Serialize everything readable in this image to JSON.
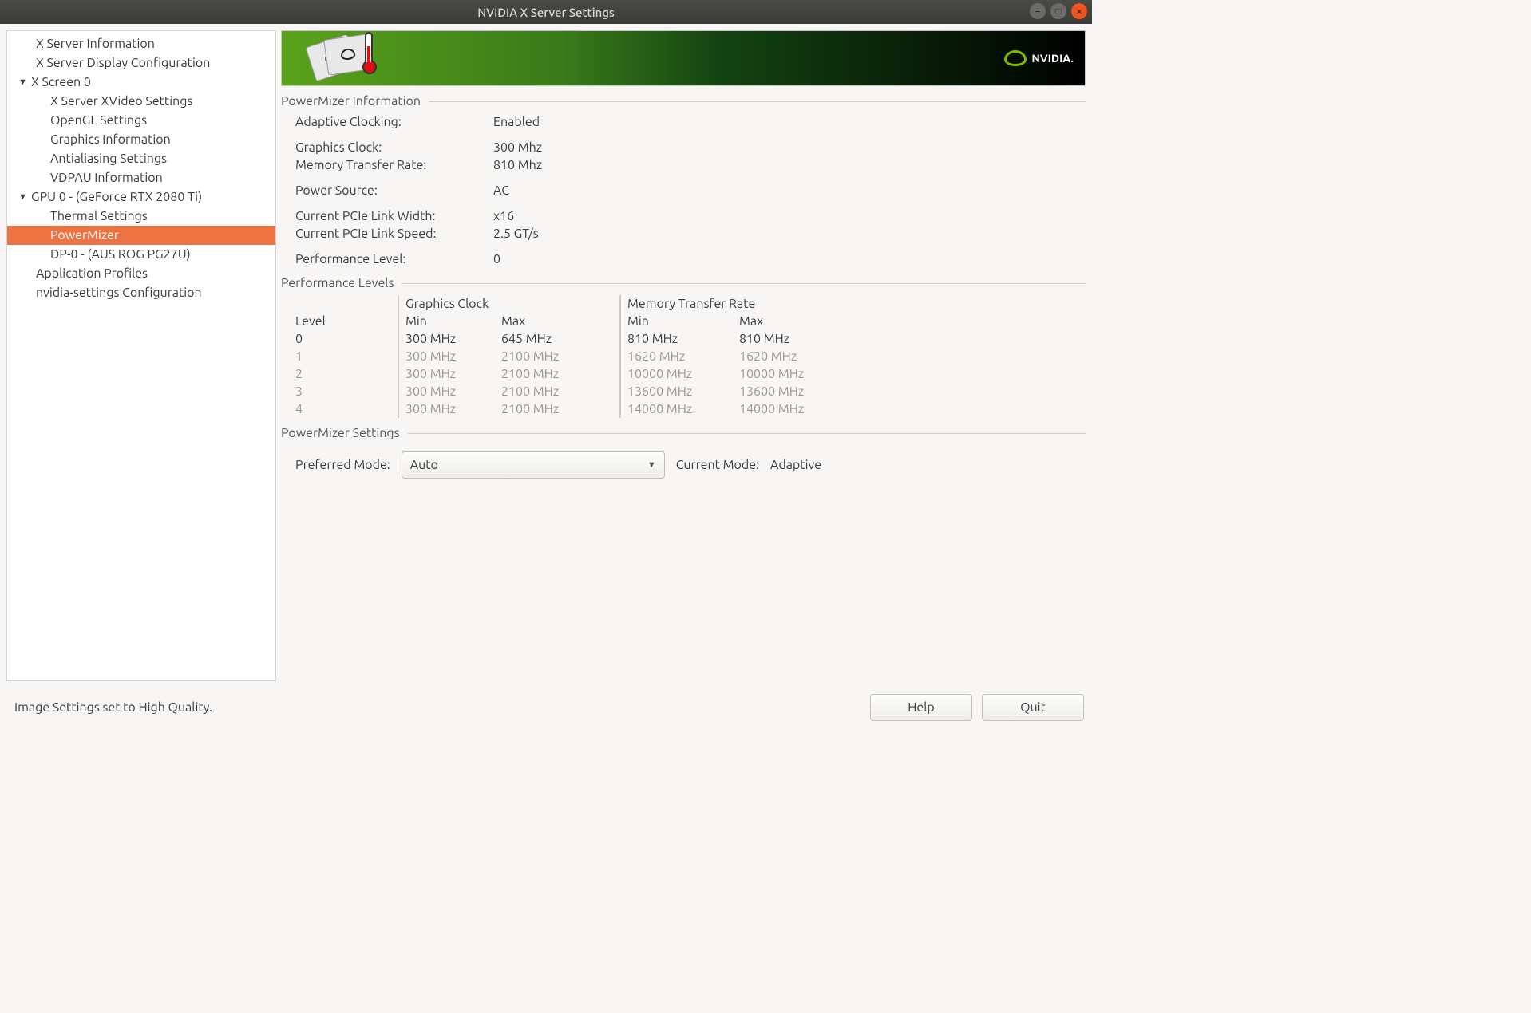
{
  "window": {
    "title": "NVIDIA X Server Settings"
  },
  "sidebar": {
    "items": [
      {
        "label": "X Server Information",
        "level": 1,
        "expandable": false
      },
      {
        "label": "X Server Display Configuration",
        "level": 1,
        "expandable": false
      },
      {
        "label": "X Screen 0",
        "level": 0,
        "expandable": true
      },
      {
        "label": "X Server XVideo Settings",
        "level": 2,
        "expandable": false
      },
      {
        "label": "OpenGL Settings",
        "level": 2,
        "expandable": false
      },
      {
        "label": "Graphics Information",
        "level": 2,
        "expandable": false
      },
      {
        "label": "Antialiasing Settings",
        "level": 2,
        "expandable": false
      },
      {
        "label": "VDPAU Information",
        "level": 2,
        "expandable": false
      },
      {
        "label": "GPU 0 - (GeForce RTX 2080 Ti)",
        "level": 0,
        "expandable": true
      },
      {
        "label": "Thermal Settings",
        "level": 2,
        "expandable": false
      },
      {
        "label": "PowerMizer",
        "level": 2,
        "expandable": false,
        "selected": true
      },
      {
        "label": "DP-0 - (AUS ROG PG27U)",
        "level": 2,
        "expandable": false
      },
      {
        "label": "Application Profiles",
        "level": 1,
        "expandable": false
      },
      {
        "label": "nvidia-settings Configuration",
        "level": 1,
        "expandable": false
      }
    ]
  },
  "sections": {
    "info_title": "PowerMizer Information",
    "levels_title": "Performance Levels",
    "settings_title": "PowerMizer Settings"
  },
  "info": {
    "adaptive_clocking_label": "Adaptive Clocking:",
    "adaptive_clocking_value": "Enabled",
    "graphics_clock_label": "Graphics Clock:",
    "graphics_clock_value": "300 Mhz",
    "mem_rate_label": "Memory Transfer Rate:",
    "mem_rate_value": "810 Mhz",
    "power_source_label": "Power Source:",
    "power_source_value": "AC",
    "pcie_width_label": "Current PCIe Link Width:",
    "pcie_width_value": "x16",
    "pcie_speed_label": "Current PCIe Link Speed:",
    "pcie_speed_value": "2.5 GT/s",
    "perf_level_label": "Performance Level:",
    "perf_level_value": "0"
  },
  "perf_headers": {
    "level": "Level",
    "graphics_clock": "Graphics Clock",
    "memory_rate": "Memory Transfer Rate",
    "min": "Min",
    "max": "Max"
  },
  "perf_levels": [
    {
      "level": "0",
      "gmin": "300 MHz",
      "gmax": "645 MHz",
      "mmin": "810 MHz",
      "mmax": "810 MHz",
      "active": true
    },
    {
      "level": "1",
      "gmin": "300 MHz",
      "gmax": "2100 MHz",
      "mmin": "1620 MHz",
      "mmax": "1620 MHz",
      "active": false
    },
    {
      "level": "2",
      "gmin": "300 MHz",
      "gmax": "2100 MHz",
      "mmin": "10000 MHz",
      "mmax": "10000 MHz",
      "active": false
    },
    {
      "level": "3",
      "gmin": "300 MHz",
      "gmax": "2100 MHz",
      "mmin": "13600 MHz",
      "mmax": "13600 MHz",
      "active": false
    },
    {
      "level": "4",
      "gmin": "300 MHz",
      "gmax": "2100 MHz",
      "mmin": "14000 MHz",
      "mmax": "14000 MHz",
      "active": false
    }
  ],
  "settings": {
    "preferred_mode_label": "Preferred Mode:",
    "preferred_mode_value": "Auto",
    "current_mode_label": "Current Mode:",
    "current_mode_value": "Adaptive"
  },
  "footer": {
    "status": "Image Settings set to High Quality.",
    "help": "Help",
    "quit": "Quit"
  },
  "logo": {
    "text": "NVIDIA."
  }
}
